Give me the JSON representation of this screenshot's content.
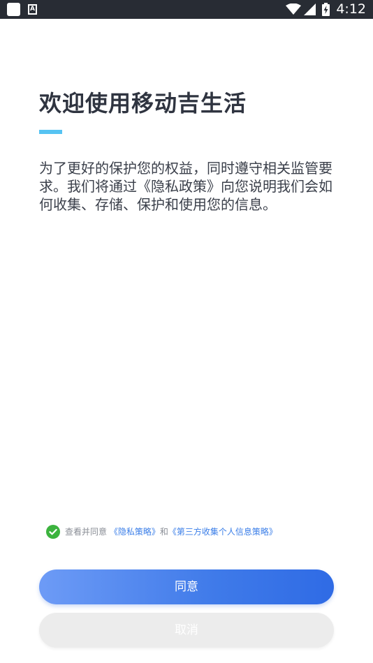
{
  "status_bar": {
    "time": "4:12",
    "left_icons": [
      "app-square-icon",
      "accessibility-a-icon"
    ],
    "right_icons": [
      "wifi-icon",
      "signal-icon",
      "battery-charging-icon"
    ],
    "a_glyph": "A"
  },
  "welcome": {
    "title": "欢迎使用移动吉生活",
    "intro": "为了更好的保护您的权益，同时遵守相关监管要求。我们将通过《隐私政策》向您说明我们会如何收集、存储、保护和使用您的信息。",
    "accent_color": "#56c3f2"
  },
  "agreement": {
    "checked": true,
    "prefix": "查看并同意",
    "privacy_link": "《隐私策略》",
    "conjunction": "和",
    "third_party_link": "《第三方收集个人信息策略》",
    "check_color": "#3cb33e",
    "link_color": "#3a7ee8"
  },
  "buttons": {
    "agree_label": "同意",
    "cancel_label": "取消",
    "agree_color": "#3f7ae9"
  }
}
